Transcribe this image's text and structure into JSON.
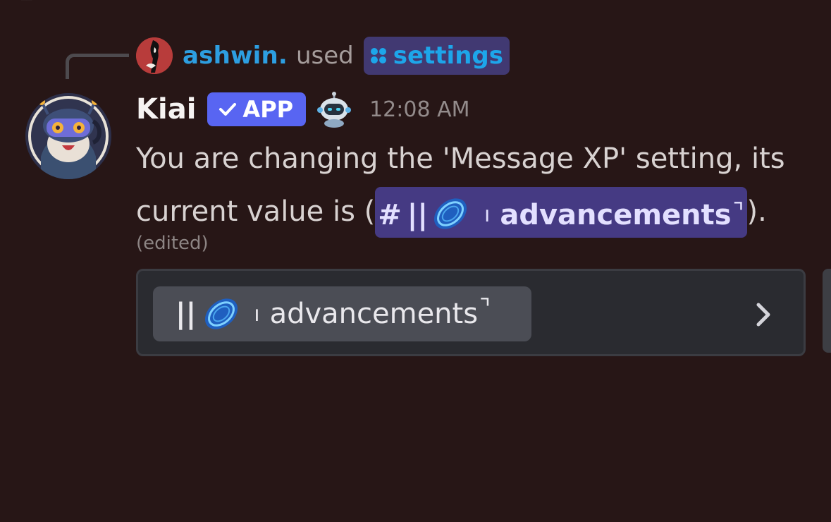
{
  "command_reply": {
    "username": "ashwin.",
    "used_text": "used",
    "command": "settings"
  },
  "message": {
    "author": "Kiai",
    "badge": "APP",
    "timestamp": "12:08 AM",
    "text_part1": "You are changing the 'Message XP' setting, its current value is (",
    "text_part2": ").",
    "edited": "(edited)"
  },
  "channel_mention": {
    "hash": "#",
    "bars": "||",
    "tick": "ı",
    "name": "advancements",
    "corner": "⌝"
  },
  "select_menu": {
    "bars": "||",
    "tick": "ı",
    "name": "advancements",
    "corner": "⌝"
  },
  "colors": {
    "background": "#271616",
    "username": "#2d9ee0",
    "app_badge": "#5865f2",
    "mention_bg": "#453a83"
  }
}
